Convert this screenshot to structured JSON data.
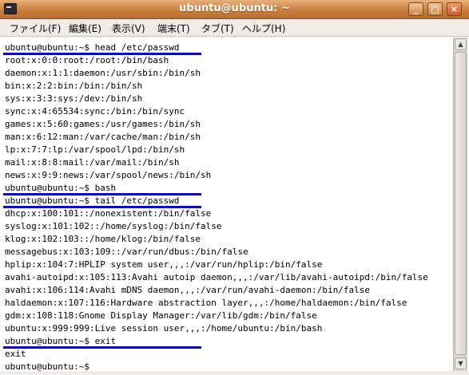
{
  "window": {
    "title": "ubuntu@ubuntu: ~",
    "minimize_glyph": "_",
    "maximize_glyph": "□",
    "close_glyph": "×"
  },
  "menu": [
    "ファイル(F)",
    "編集(E)",
    "表示(V)",
    "端末(T)",
    "タブ(T)",
    "ヘルプ(H)"
  ],
  "terminal": {
    "lines": [
      "ubuntu@ubuntu:~$ head /etc/passwd",
      "root:x:0:0:root:/root:/bin/bash",
      "daemon:x:1:1:daemon:/usr/sbin:/bin/sh",
      "bin:x:2:2:bin:/bin:/bin/sh",
      "sys:x:3:3:sys:/dev:/bin/sh",
      "sync:x:4:65534:sync:/bin:/bin/sync",
      "games:x:5:60:games:/usr/games:/bin/sh",
      "man:x:6:12:man:/var/cache/man:/bin/sh",
      "lp:x:7:7:lp:/var/spool/lpd:/bin/sh",
      "mail:x:8:8:mail:/var/mail:/bin/sh",
      "news:x:9:9:news:/var/spool/news:/bin/sh",
      "ubuntu@ubuntu:~$ bash",
      "ubuntu@ubuntu:~$ tail /etc/passwd",
      "dhcp:x:100:101::/nonexistent:/bin/false",
      "syslog:x:101:102::/home/syslog:/bin/false",
      "klog:x:102:103::/home/klog:/bin/false",
      "messagebus:x:103:109::/var/run/dbus:/bin/false",
      "hplip:x:104:7:HPLIP system user,,,:/var/run/hplip:/bin/false",
      "avahi-autoipd:x:105:113:Avahi autoip daemon,,,:/var/lib/avahi-autoipd:/bin/false",
      "avahi:x:106:114:Avahi mDNS daemon,,,:/var/run/avahi-daemon:/bin/false",
      "haldaemon:x:107:116:Hardware abstraction layer,,,:/home/haldaemon:/bin/false",
      "gdm:x:108:118:Gnome Display Manager:/var/lib/gdm:/bin/false",
      "ubuntu:x:999:999:Live session user,,,:/home/ubuntu:/bin/bash",
      "ubuntu@ubuntu:~$ exit",
      "exit",
      "ubuntu@ubuntu:~$"
    ],
    "underlined_line_indices": [
      0,
      11,
      12,
      23
    ],
    "underline_color": "#0a0ad0"
  },
  "colors": {
    "titlebar": "#c9803f",
    "menubar": "#efebe7",
    "terminal_bg": "#ffffff",
    "terminal_fg": "#000000"
  }
}
